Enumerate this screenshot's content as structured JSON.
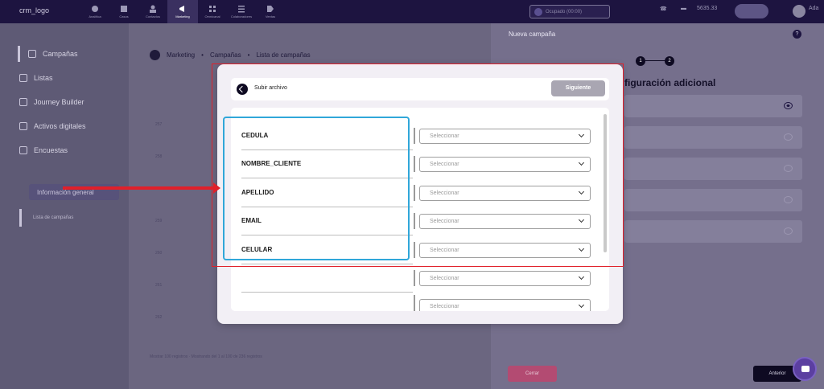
{
  "topbar": {
    "logo_alt": "crm_logo",
    "nav": [
      {
        "label": "Analítica",
        "icon": "chart-icon"
      },
      {
        "label": "Casos",
        "icon": "layers-icon"
      },
      {
        "label": "Contactos",
        "icon": "users-icon"
      },
      {
        "label": "Marketing",
        "icon": "megaphone-icon",
        "active": true
      },
      {
        "label": "Omnicanal",
        "icon": "grid-icon"
      },
      {
        "label": "Colaboradores",
        "icon": "list-icon"
      },
      {
        "label": "Ventas",
        "icon": "tag-icon"
      }
    ],
    "status_text": "Ocupado (00:00)",
    "balance": "5635.33",
    "user_short": "Ada"
  },
  "sidebar": {
    "items": [
      {
        "label": "Campañas",
        "icon": "megaphone-icon"
      },
      {
        "label": "Listas",
        "icon": "list-icon"
      },
      {
        "label": "Journey Builder",
        "icon": "person-icon"
      },
      {
        "label": "Activos digitales",
        "icon": "grid-icon"
      },
      {
        "label": "Encuestas",
        "icon": "clipboard-icon"
      }
    ],
    "info_button": "Información general",
    "sub_item": "Lista de campañas"
  },
  "breadcrumb": {
    "root": "Marketing",
    "middle": "Campañas",
    "current": "Lista de campañas"
  },
  "background_rows": [
    "257",
    "258",
    "259",
    "260",
    "261",
    "262"
  ],
  "footer_text": "Mostrar 100 registros · Mostrando del 1 al 100 de 236 registros",
  "right_panel": {
    "title": "Nueva campaña",
    "steps": [
      "1",
      "2"
    ],
    "section_heading": "figuración adicional",
    "cancel_label": "Cerrar",
    "prev_label": "Anterior"
  },
  "modal": {
    "title": "Subir archivo",
    "next_label": "Siguiente",
    "fields": [
      "CEDULA",
      "NOMBRE_CLIENTE",
      "APELLIDO",
      "EMAIL",
      "CELULAR",
      "",
      ""
    ],
    "select_placeholder": "Seleccionar"
  },
  "colors": {
    "annotation_red": "#e0202a",
    "annotation_blue": "#30a7d9",
    "dark_navy": "#0e0a22"
  }
}
